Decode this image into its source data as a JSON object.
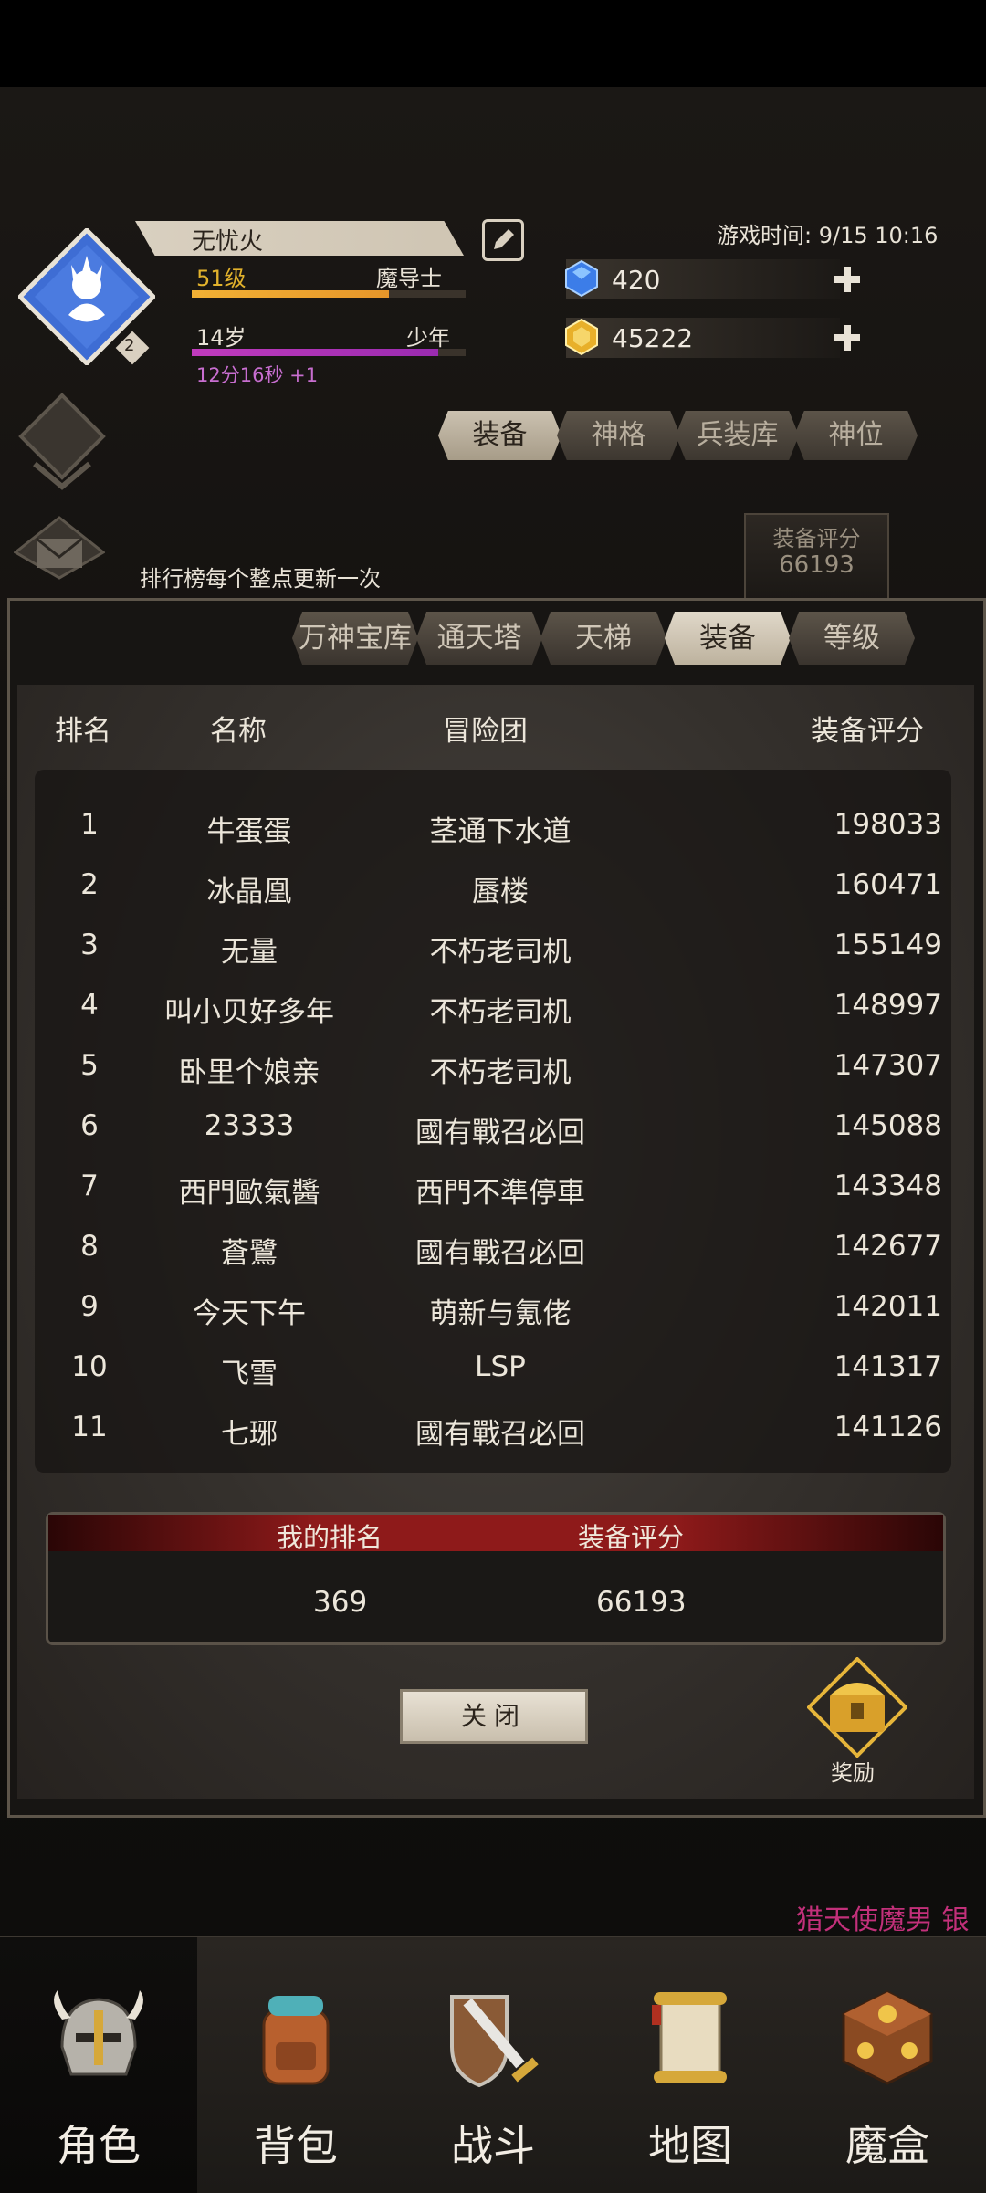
{
  "header": {
    "player_name": "无忧火",
    "level": "51级",
    "class_name": "魔导士",
    "level_progress": 0.72,
    "age": "14岁",
    "life_stage": "少年",
    "age_progress": 0.9,
    "timer": "12分16秒 +1",
    "avatar_badge": "2",
    "game_time": "游戏时间: 9/15 10:16",
    "gems": "420",
    "gold": "45222"
  },
  "notice": "排行榜每个整点更新一次",
  "outer_tabs": [
    "装备",
    "神格",
    "兵装库",
    "神位"
  ],
  "score_plaque": {
    "label": "装备评分",
    "value": "66193"
  },
  "ranking": {
    "tabs": [
      "万神宝库",
      "通天塔",
      "天梯",
      "装备",
      "等级"
    ],
    "active_tab": 3,
    "headers": {
      "rank": "排名",
      "name": "名称",
      "guild": "冒险团",
      "score": "装备评分"
    },
    "rows": [
      {
        "rank": "1",
        "name": "牛蛋蛋",
        "guild": "茎通下水道",
        "score": "198033"
      },
      {
        "rank": "2",
        "name": "冰晶凰",
        "guild": "蜃楼",
        "score": "160471"
      },
      {
        "rank": "3",
        "name": "无量",
        "guild": "不朽老司机",
        "score": "155149"
      },
      {
        "rank": "4",
        "name": "叫小贝好多年",
        "guild": "不朽老司机",
        "score": "148997"
      },
      {
        "rank": "5",
        "name": "卧里个娘亲",
        "guild": "不朽老司机",
        "score": "147307"
      },
      {
        "rank": "6",
        "name": "23333",
        "guild": "國有戰召必回",
        "score": "145088"
      },
      {
        "rank": "7",
        "name": "西門歐氣醬",
        "guild": "西門不準停車",
        "score": "143348"
      },
      {
        "rank": "8",
        "name": "蒼鷺",
        "guild": "國有戰召必回",
        "score": "142677"
      },
      {
        "rank": "9",
        "name": "今天下午",
        "guild": "萌新与氪佬",
        "score": "142011"
      },
      {
        "rank": "10",
        "name": "飞雪",
        "guild": "LSP",
        "score": "141317"
      },
      {
        "rank": "11",
        "name": "七琊",
        "guild": "國有戰召必回",
        "score": "141126"
      }
    ],
    "my_rank_label": "我的排名",
    "my_score_label": "装备评分",
    "my_rank": "369",
    "my_score": "66193",
    "close_label": "关闭",
    "reward_label": "奖励"
  },
  "marquee": "猎天使魔男 银",
  "bottom_nav": [
    {
      "label": "角色",
      "icon": "helmet-icon"
    },
    {
      "label": "背包",
      "icon": "backpack-icon"
    },
    {
      "label": "战斗",
      "icon": "sword-shield-icon"
    },
    {
      "label": "地图",
      "icon": "scroll-map-icon"
    },
    {
      "label": "魔盒",
      "icon": "magic-box-icon"
    }
  ],
  "colors": {
    "gold": "#e2b22c",
    "purple": "#c03bbd",
    "accent_red": "#8e1a1a"
  }
}
